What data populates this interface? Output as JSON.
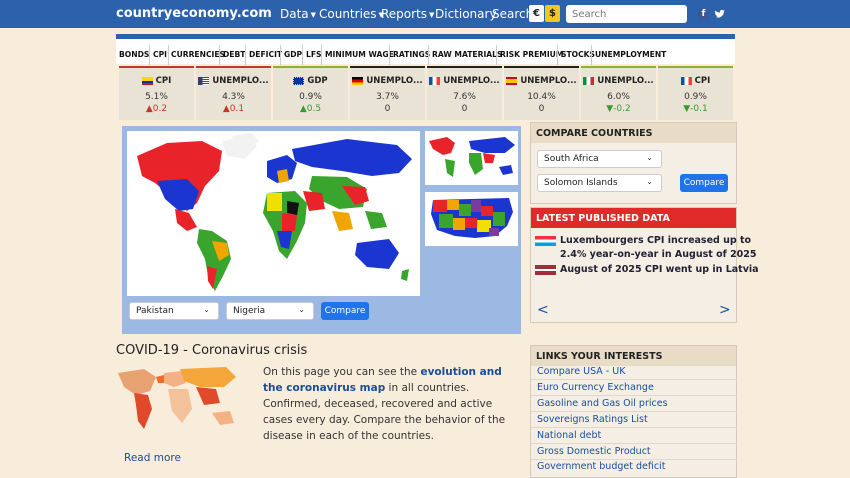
{
  "brand": "countryeconomy.com",
  "nav": {
    "data": "Data",
    "countries": "Countries",
    "reports": "Reports",
    "dictionary": "Dictionary",
    "search": "Search",
    "currency_euro": "€",
    "currency_dollar": "$",
    "search_placeholder": "Search"
  },
  "tabs": [
    "BONDS",
    "CPI",
    "CURRENCIES",
    "DEBT",
    "DEFICIT",
    "GDP",
    "LFS",
    "MINIMUM WAGE",
    "RATINGS",
    "RAW MATERIALS",
    "RISK PREMIUM",
    "STOCKS",
    "UNEMPLOYMENT"
  ],
  "cards": [
    {
      "label": "CPI",
      "value": "5.1%",
      "delta": "0.2",
      "dir": "up",
      "flag": "colombia"
    },
    {
      "label": "UNEMPLO...",
      "value": "4.3%",
      "delta": "0.1",
      "dir": "up",
      "flag": "usa"
    },
    {
      "label": "GDP",
      "value": "0.9%",
      "delta": "0.5",
      "dir": "up",
      "flag": "eu"
    },
    {
      "label": "UNEMPLO...",
      "value": "3.7%",
      "delta": "0",
      "dir": "zero",
      "flag": "germany"
    },
    {
      "label": "UNEMPLO...",
      "value": "7.6%",
      "delta": "0",
      "dir": "zero",
      "flag": "france"
    },
    {
      "label": "UNEMPLO...",
      "value": "10.4%",
      "delta": "0",
      "dir": "zero",
      "flag": "spain"
    },
    {
      "label": "UNEMPLO...",
      "value": "6.0%",
      "delta": "-0.2",
      "dir": "down",
      "flag": "italy"
    },
    {
      "label": "CPI",
      "value": "0.9%",
      "delta": "-0.1",
      "dir": "down",
      "flag": "france"
    }
  ],
  "map_compare": {
    "country_a": "Pakistan",
    "country_b": "Nigeria",
    "button": "Compare"
  },
  "compare_countries": {
    "title": "COMPARE COUNTRIES",
    "country_a": "South Africa",
    "country_b": "Solomon Islands",
    "button": "Compare"
  },
  "latest": {
    "title": "LATEST PUBLISHED DATA",
    "items": [
      {
        "text_line1": "Luxembourgers CPI increased up to",
        "text_line2": "2.4% year-on-year in August of 2025",
        "flag": "luxembourg"
      },
      {
        "text_line1": "August of 2025 CPI went up in Latvia",
        "flag": "latvia"
      }
    ],
    "prev": "<",
    "next": ">"
  },
  "covid": {
    "title": "COVID-19 - Coronavirus crisis",
    "text_a": "On this page you can see the ",
    "text_bold": "evolution and the coronavirus map",
    "text_b": " in all countries. Confirmed, deceased, recovered and active cases every day. Compare the behavior of the disease in each of the countries.",
    "read_more": "Read more"
  },
  "links": {
    "title": "LINKS YOUR INTERESTS",
    "items": [
      "Compare USA - UK",
      "Euro Currency Exchange",
      "Gasoline and Gas Oil prices",
      "Sovereigns Ratings List",
      "National debt",
      "Gross Domestic Product",
      "Government budget deficit"
    ]
  },
  "colors": {
    "nav": "#2c61ab",
    "background": "#f8ecdb",
    "latest_header": "#e02a2a",
    "button": "#1e74e8"
  }
}
